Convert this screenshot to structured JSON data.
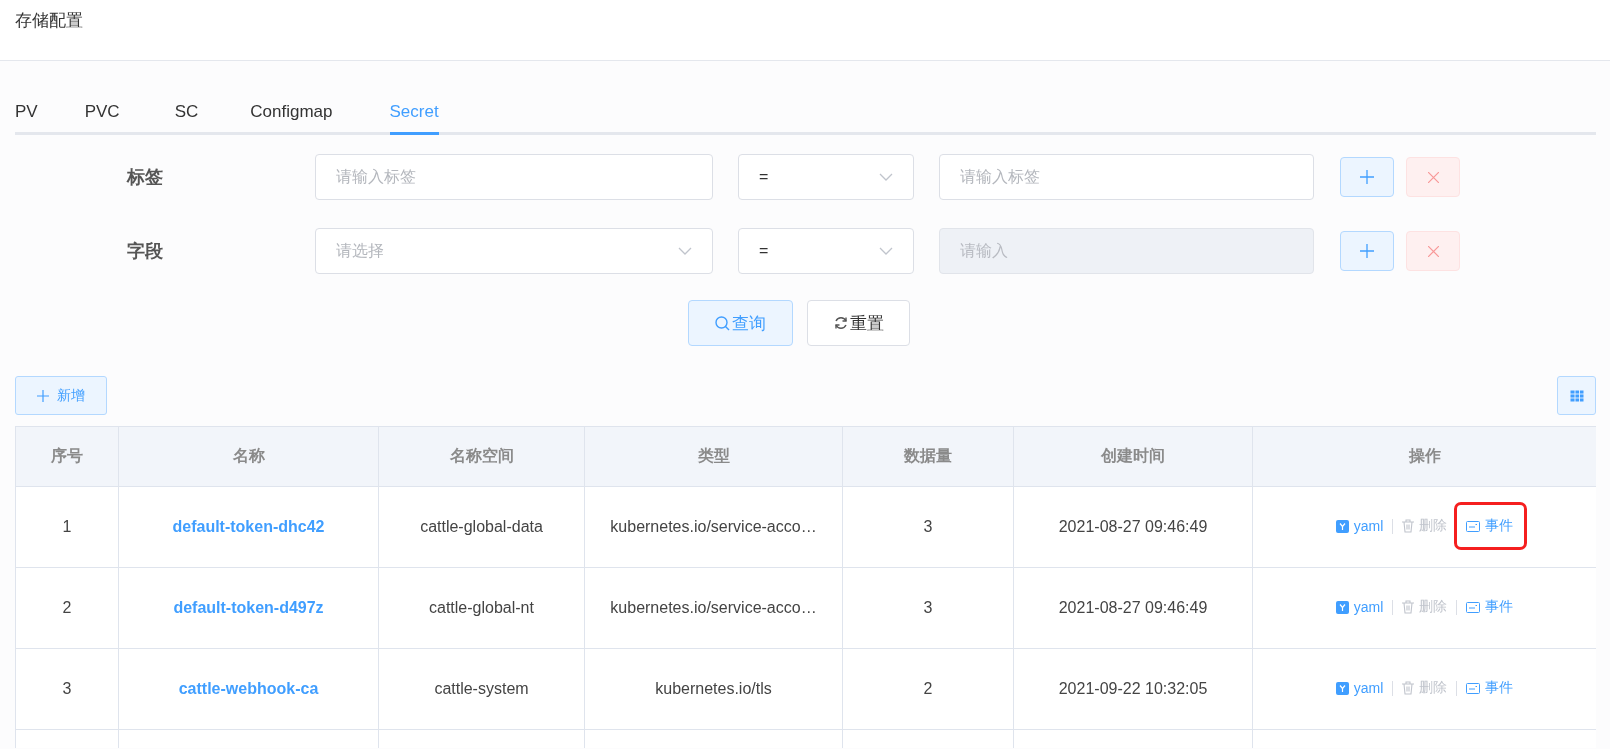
{
  "page_title": "存储配置",
  "tabs": [
    {
      "label": "PV",
      "selected": false
    },
    {
      "label": "PVC",
      "selected": false
    },
    {
      "label": "SC",
      "selected": false
    },
    {
      "label": "Configmap",
      "selected": false
    },
    {
      "label": "Secret",
      "selected": true
    }
  ],
  "filters": [
    {
      "label": "标签",
      "field": {
        "kind": "input",
        "placeholder": "请输入标签"
      },
      "operator": "=",
      "value": {
        "placeholder": "请输入标签",
        "disabled": false
      }
    },
    {
      "label": "字段",
      "field": {
        "kind": "select",
        "placeholder": "请选择"
      },
      "operator": "=",
      "value": {
        "placeholder": "请输入",
        "disabled": true
      }
    }
  ],
  "search_button": "查询",
  "reset_button": "重置",
  "add_button": "新增",
  "table": {
    "columns": [
      "序号",
      "名称",
      "名称空间",
      "类型",
      "数据量",
      "创建时间",
      "操作"
    ],
    "rows": [
      {
        "index": "1",
        "name": "default-token-dhc42",
        "namespace": "cattle-global-data",
        "type": "kubernetes.io/service-acco…",
        "data_count": "3",
        "created": "2021-08-27 09:46:49",
        "actions": [
          {
            "kind": "yaml",
            "label": "yaml",
            "disabled": false,
            "highlighted": false
          },
          {
            "kind": "delete",
            "label": "删除",
            "disabled": true,
            "highlighted": false
          },
          {
            "kind": "events",
            "label": "事件",
            "disabled": false,
            "highlighted": true
          }
        ]
      },
      {
        "index": "2",
        "name": "default-token-d497z",
        "namespace": "cattle-global-nt",
        "type": "kubernetes.io/service-acco…",
        "data_count": "3",
        "created": "2021-08-27 09:46:49",
        "actions": [
          {
            "kind": "yaml",
            "label": "yaml",
            "disabled": false,
            "highlighted": false
          },
          {
            "kind": "delete",
            "label": "删除",
            "disabled": true,
            "highlighted": false
          },
          {
            "kind": "events",
            "label": "事件",
            "disabled": false,
            "highlighted": false
          }
        ]
      },
      {
        "index": "3",
        "name": "cattle-webhook-ca",
        "namespace": "cattle-system",
        "type": "kubernetes.io/tls",
        "data_count": "2",
        "created": "2021-09-22 10:32:05",
        "actions": [
          {
            "kind": "yaml",
            "label": "yaml",
            "disabled": false,
            "highlighted": false
          },
          {
            "kind": "delete",
            "label": "删除",
            "disabled": true,
            "highlighted": false
          },
          {
            "kind": "events",
            "label": "事件",
            "disabled": false,
            "highlighted": false
          }
        ]
      }
    ]
  }
}
